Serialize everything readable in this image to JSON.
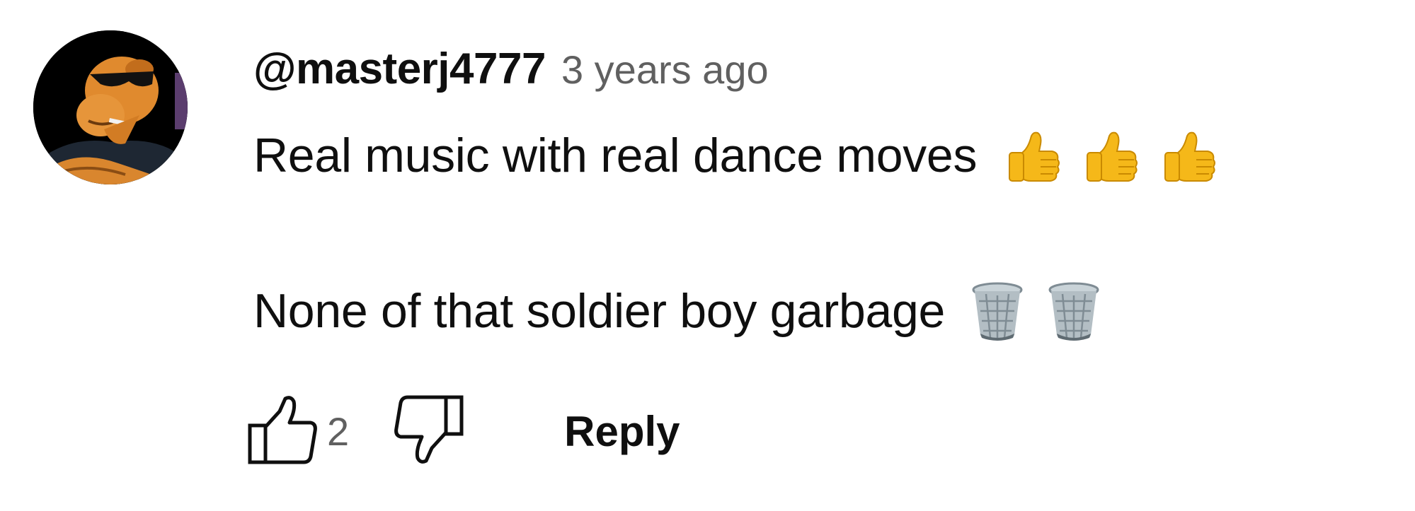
{
  "comment": {
    "author": "@masterj4777",
    "time": "3 years ago",
    "line1_text": "Real music with real dance moves",
    "line1_emoji": [
      "thumbs-up-emoji",
      "thumbs-up-emoji",
      "thumbs-up-emoji"
    ],
    "line2_text": "None of that soldier boy garbage",
    "line2_emoji": [
      "wastebasket-emoji",
      "wastebasket-emoji"
    ],
    "like_count": "2",
    "reply_label": "Reply"
  },
  "icons": {
    "like": "thumbs-up-outline-icon",
    "dislike": "thumbs-down-outline-icon"
  },
  "colors": {
    "text_primary": "#0f0f0f",
    "text_secondary": "#606060",
    "emoji_yellow": "#f5b819",
    "trash_gray": "#7f8c94"
  }
}
